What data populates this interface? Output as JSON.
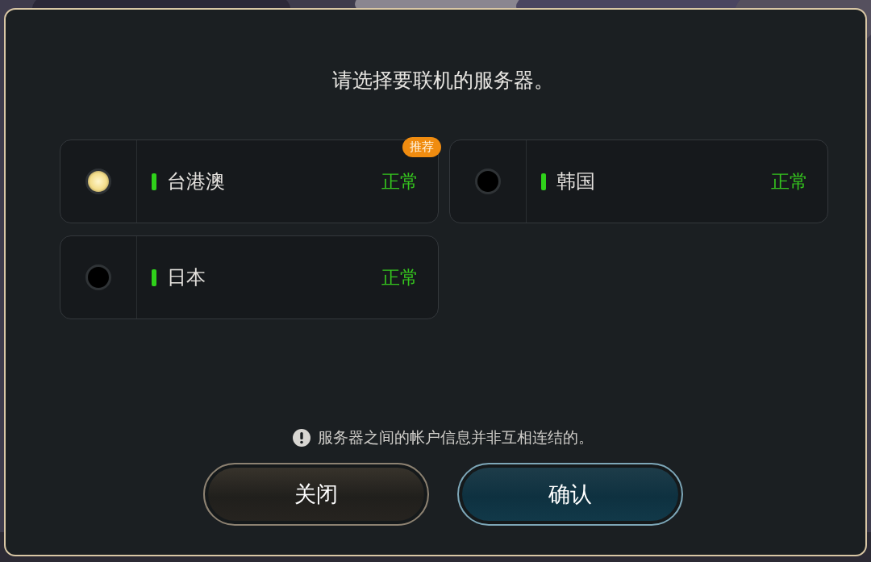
{
  "dialog": {
    "title": "请选择要联机的服务器。",
    "servers": [
      {
        "name": "台港澳",
        "status": "正常",
        "selected": true,
        "badge": "推荐"
      },
      {
        "name": "韩国",
        "status": "正常",
        "selected": false
      },
      {
        "name": "日本",
        "status": "正常",
        "selected": false
      }
    ],
    "note": "服务器之间的帐户信息并非互相连结的。",
    "buttons": [
      {
        "label": "关闭",
        "kind": "secondary"
      },
      {
        "label": "确认",
        "kind": "primary"
      }
    ]
  }
}
